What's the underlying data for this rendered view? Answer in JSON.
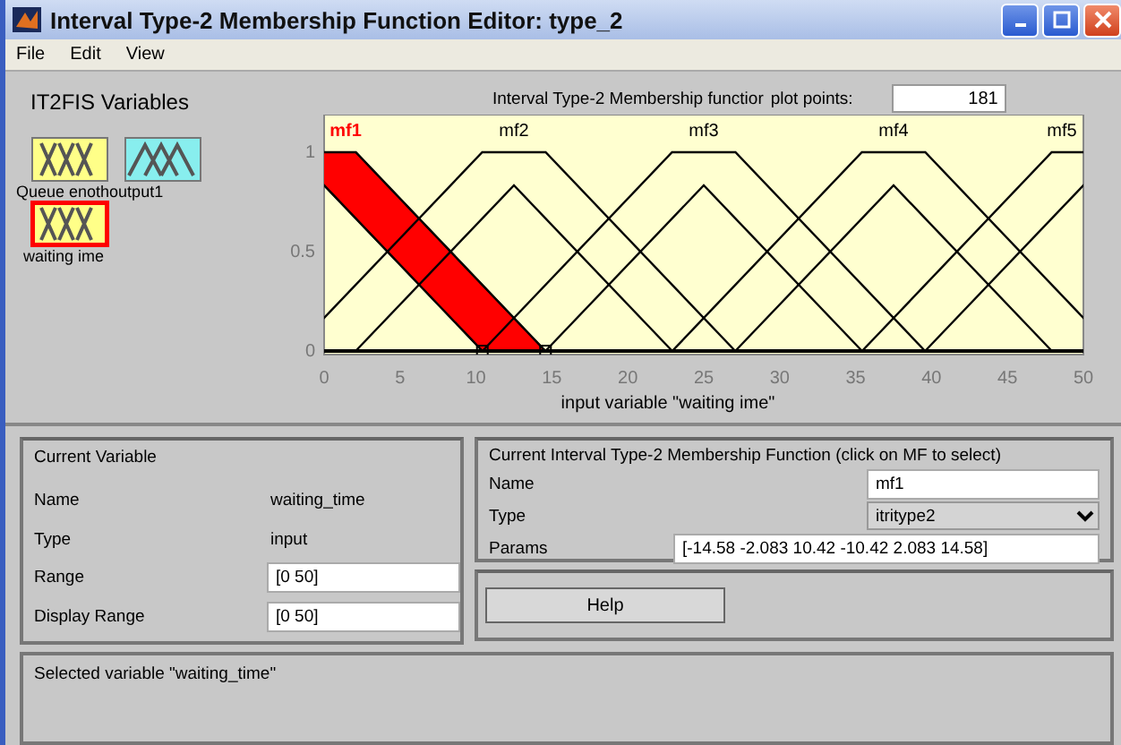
{
  "window": {
    "title": "Interval Type-2 Membership Function Editor: type_2"
  },
  "menu": [
    "File",
    "Edit",
    "View"
  ],
  "variables_panel": {
    "title": "IT2FIS Variables",
    "items": [
      {
        "label": "Queue enoth",
        "kind": "input",
        "selected": false
      },
      {
        "label": "output1",
        "kind": "output",
        "selected": false
      },
      {
        "label": "waiting ime",
        "kind": "input",
        "selected": true
      }
    ]
  },
  "plot": {
    "title": "Interval Type-2 Membership functior",
    "plot_points_label": "plot points:",
    "plot_points": "181",
    "mf_labels": [
      {
        "label": "mf1",
        "selected": true
      },
      {
        "label": "mf2",
        "selected": false
      },
      {
        "label": "mf3",
        "selected": false
      },
      {
        "label": "mf4",
        "selected": false
      },
      {
        "label": "mf5",
        "selected": false
      }
    ],
    "y_ticks": [
      "1",
      "0.5",
      "0"
    ],
    "x_ticks": [
      "0",
      "5",
      "10",
      "15",
      "20",
      "25",
      "30",
      "35",
      "40",
      "45",
      "50"
    ],
    "xlabel": "input variable \"waiting ime\""
  },
  "current_variable": {
    "title": "Current Variable",
    "rows": [
      {
        "label": "Name",
        "value": "waiting_time",
        "kind": "text"
      },
      {
        "label": "Type",
        "value": "input",
        "kind": "text"
      },
      {
        "label": "Range",
        "value": "[0 50]",
        "kind": "field"
      },
      {
        "label": "Display Range",
        "value": "[0 50]",
        "kind": "field"
      }
    ]
  },
  "current_mf": {
    "title": "Current Interval Type-2 Membership Function (click on MF to select)",
    "rows": [
      {
        "label": "Name",
        "value": "mf1",
        "kind": "field"
      },
      {
        "label": "Type",
        "value": "itritype2",
        "kind": "dropdown"
      },
      {
        "label": "Params",
        "value": "[-14.58 -2.083 10.42 -10.42 2.083 14.58]",
        "kind": "field"
      }
    ]
  },
  "help_button": "Help",
  "status": "Selected variable \"waiting_time\""
}
